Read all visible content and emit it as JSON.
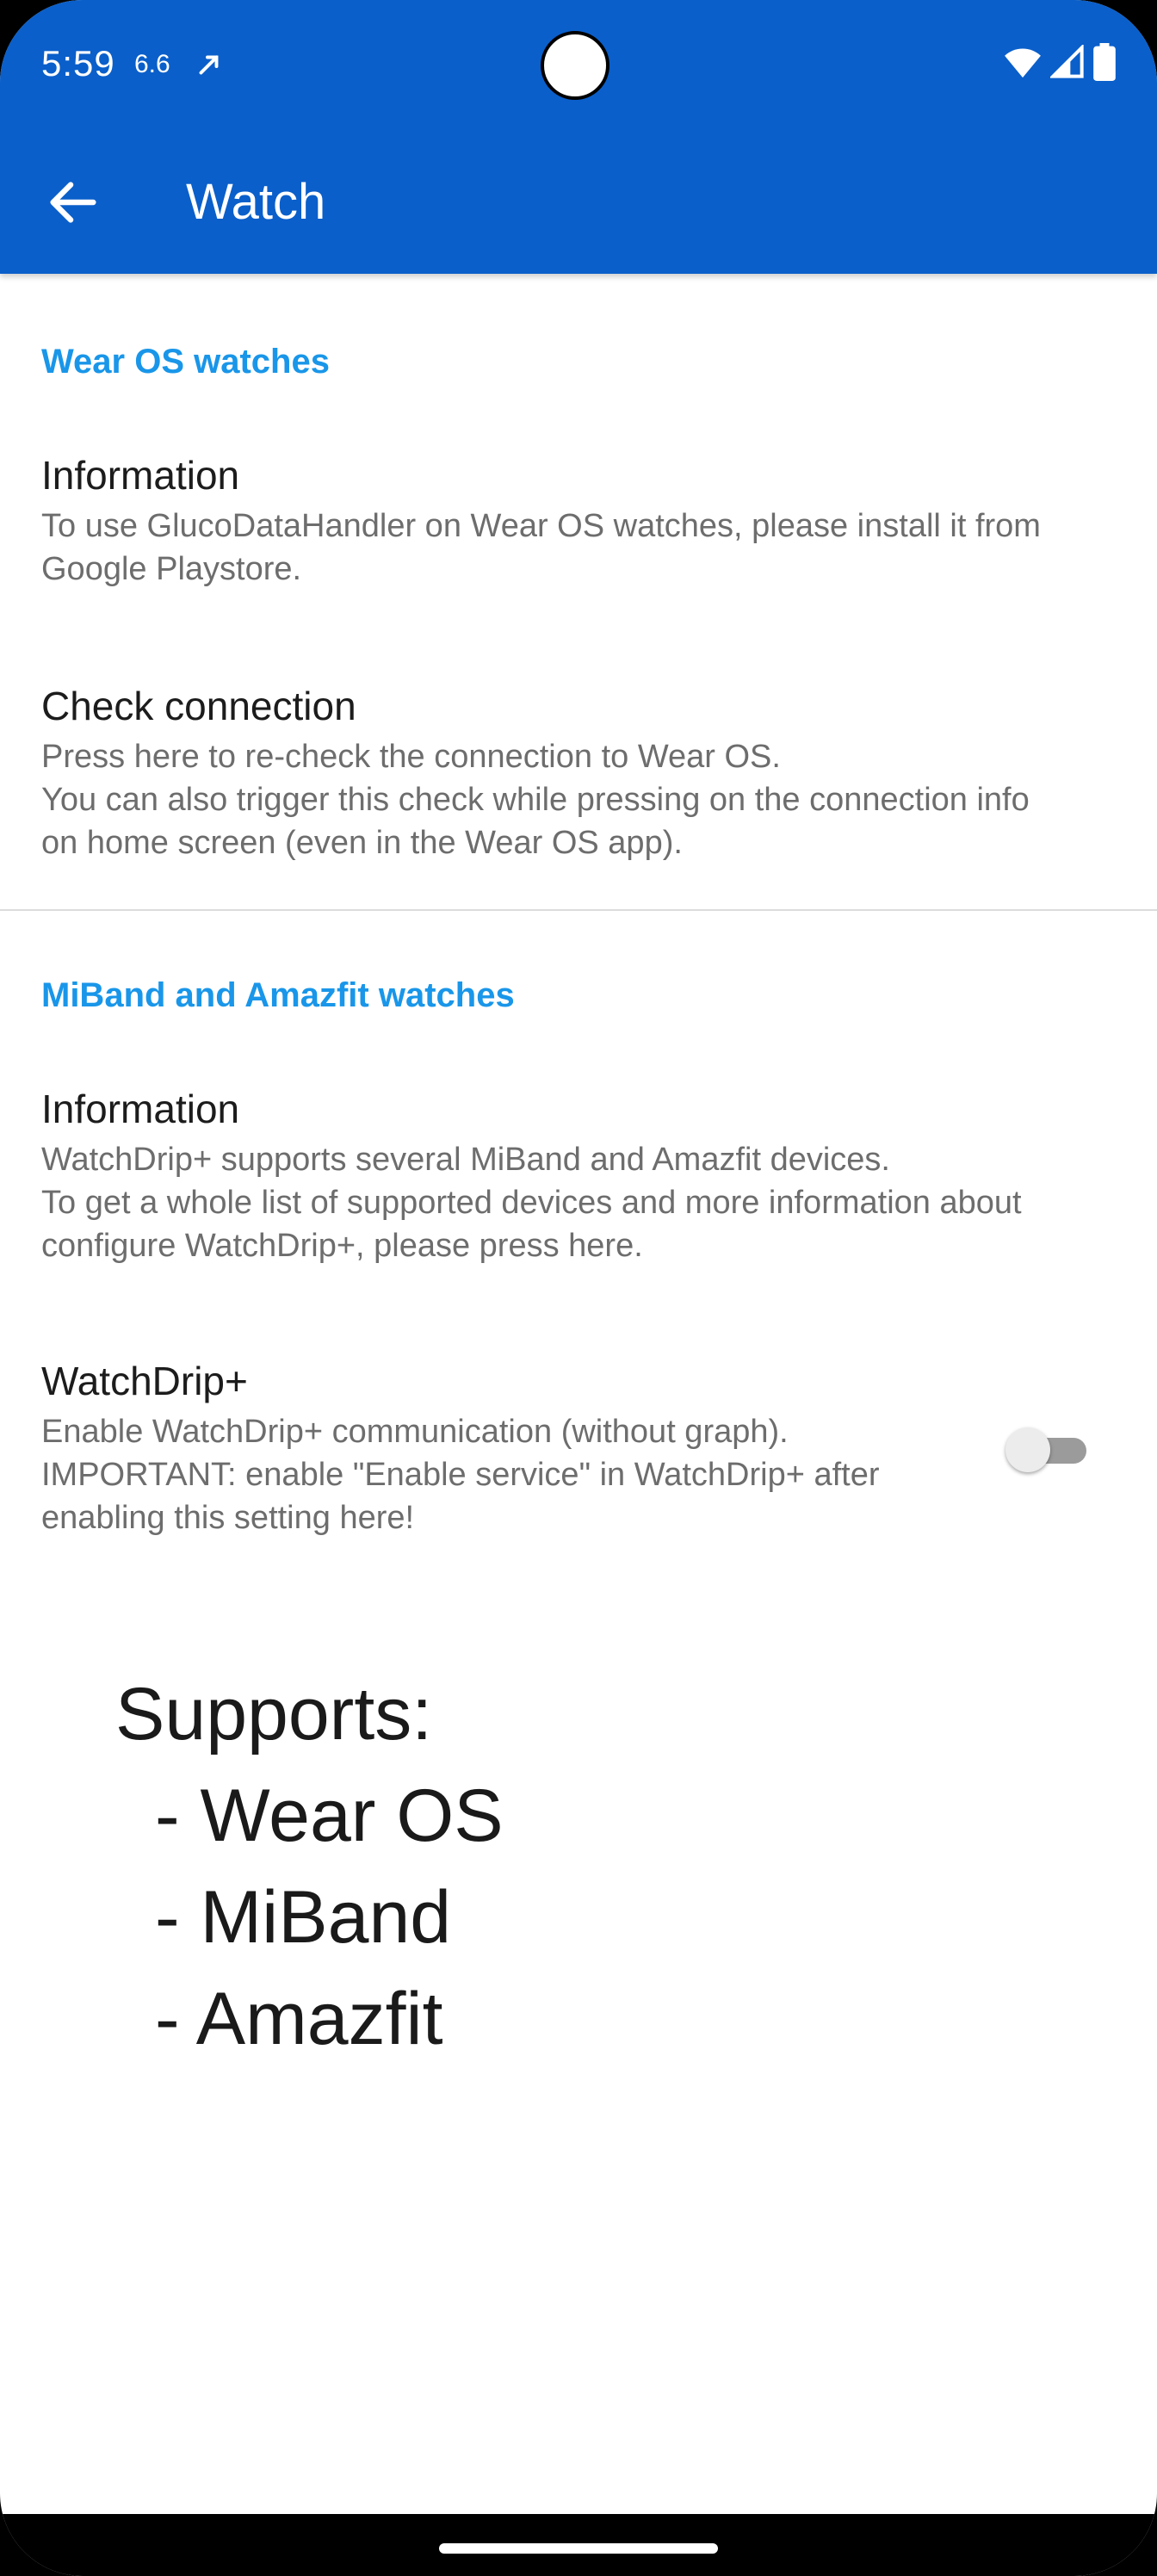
{
  "status_bar": {
    "time": "5:59",
    "extra": "6.6"
  },
  "app_bar": {
    "title": "Watch"
  },
  "sections": [
    {
      "header": "Wear OS watches",
      "items": [
        {
          "title": "Information",
          "summary": "To use GlucoDataHandler on Wear OS watches, please install it from Google Playstore."
        },
        {
          "title": "Check connection",
          "summary_lines": [
            "Press here to re-check the connection to Wear OS.",
            "You can also trigger this check while pressing on the connection info on home screen (even in the Wear OS app)."
          ]
        }
      ]
    },
    {
      "header": "MiBand and Amazfit watches",
      "items": [
        {
          "title": "Information",
          "summary_lines": [
            "WatchDrip+ supports several MiBand and Amazfit devices.",
            "To get a whole list of supported devices and more information about configure WatchDrip+, please press here."
          ]
        },
        {
          "title": "WatchDrip+",
          "summary_lines": [
            "Enable WatchDrip+ communication (without graph).",
            "IMPORTANT: enable \"Enable service\" in WatchDrip+ after enabling this setting here!"
          ],
          "toggle_on": false
        }
      ]
    }
  ],
  "supports": {
    "heading": "Supports:",
    "items": [
      "- Wear OS",
      "- MiBand",
      "- Amazfit"
    ]
  },
  "colors": {
    "app_bar": "#0a5fca",
    "accent": "#1996e9"
  }
}
